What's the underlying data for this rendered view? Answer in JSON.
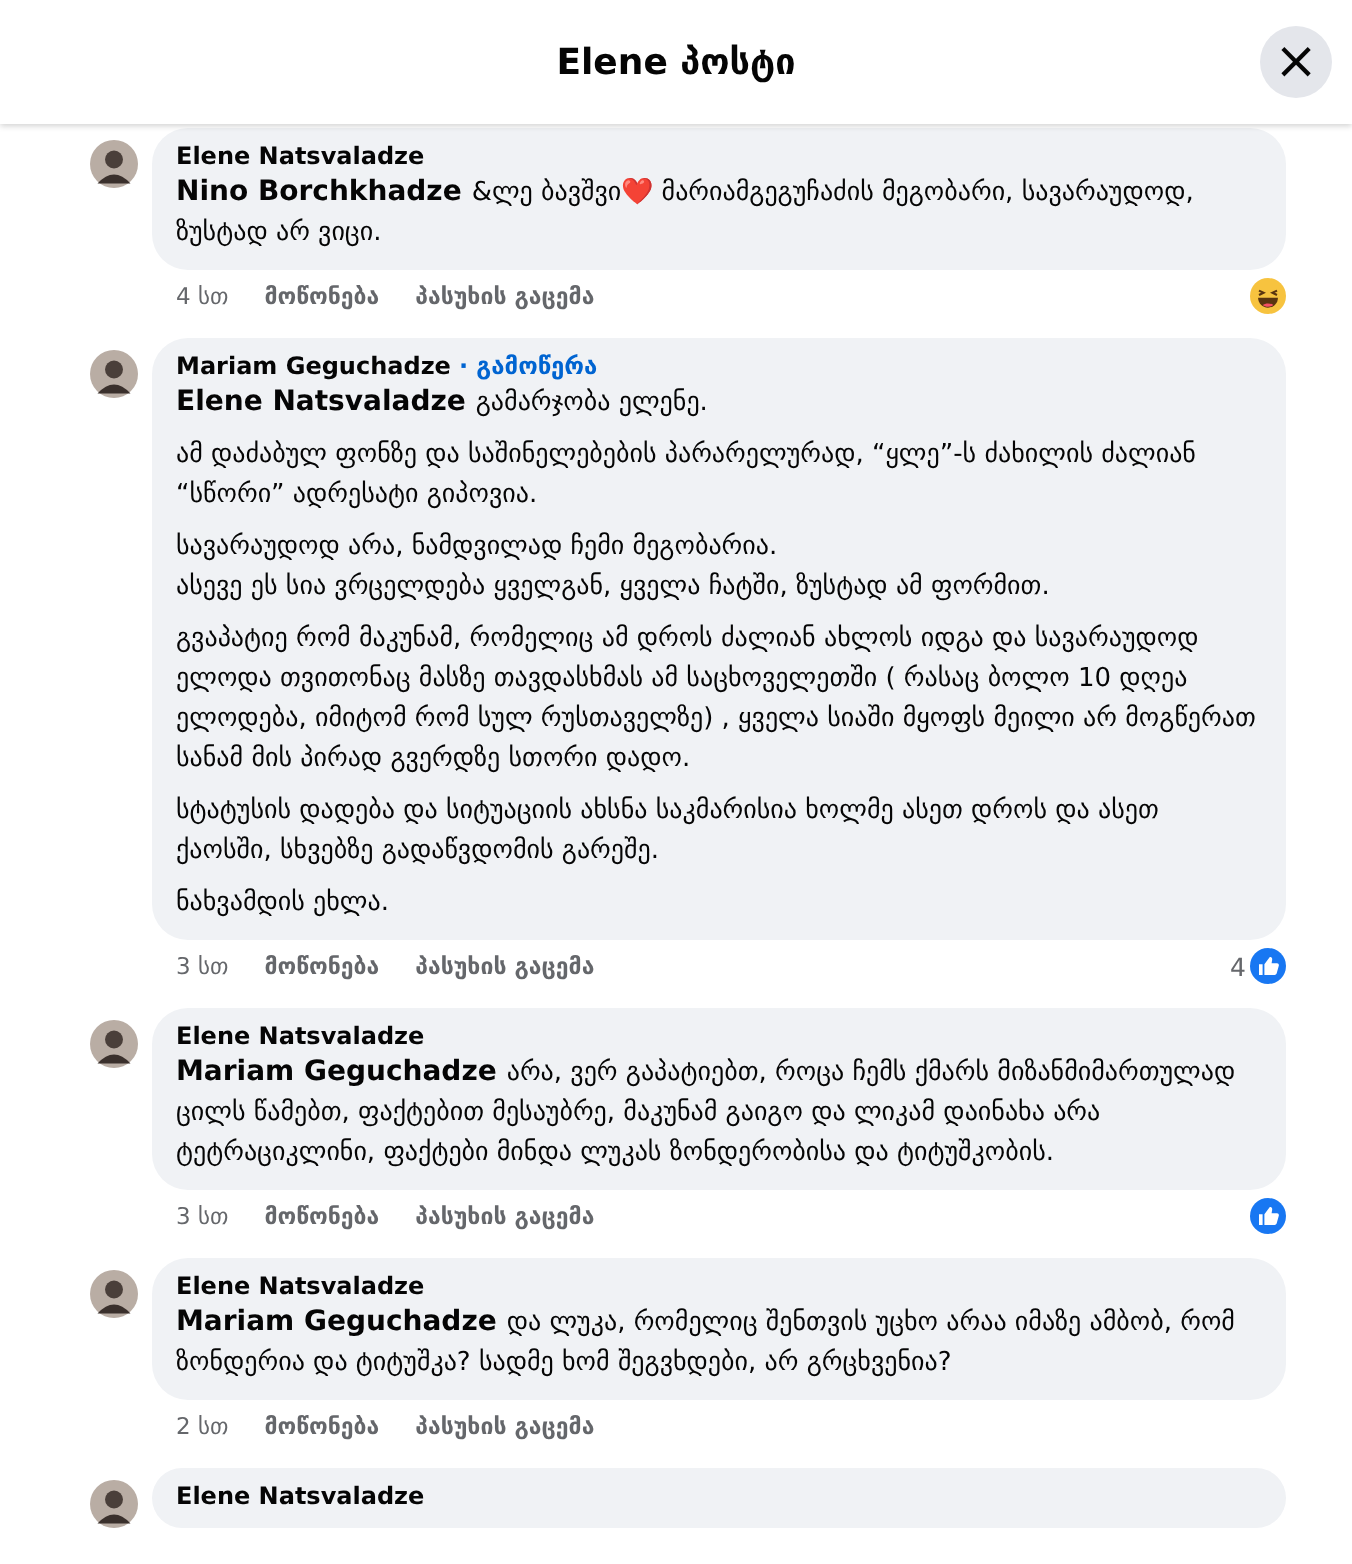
{
  "header": {
    "title": "Elene პოსტი",
    "close": "×"
  },
  "comments": [
    {
      "author": "Elene Natsvaladze",
      "mention": "Nino Borchkhadze",
      "paragraphs": [
        "&ლე ბავშვი❤️ მარიამგეგუჩაძის მეგობარი, სავარაუდოდ, ზუსტად არ ვიცი."
      ],
      "time": "4 სთ",
      "like": "მოწონება",
      "reply": "პასუხის გაცემა",
      "reaction": {
        "kind": "haha"
      }
    },
    {
      "author": "Mariam Geguchadze",
      "follow": "· გამოწერა",
      "mention": "Elene Natsvaladze",
      "paragraphs": [
        "გამარჯობა ელენე.",
        "ამ დაძაბულ ფონზე და საშინელებების პარარელურად, “ყლე”-ს ძახილის ძალიან “სწორი” ადრესატი გიპოვია.",
        "სავარაუდოდ არა, ნამდვილად ჩემი მეგობარია.\nასევე ეს სია ვრცელდება ყველგან, ყველა ჩატში, ზუსტად ამ ფორმით.",
        "გვაპატიე რომ მაკუნამ, რომელიც ამ დროს ძალიან ახლოს იდგა და სავარაუდოდ ელოდა თვითონაც მასზე თავდასხმას ამ საცხოველეთში ( რასაც ბოლო 10 დღეა ელოდება, იმიტომ რომ სულ რუსთაველზე) , ყველა სიაში მყოფს მეილი არ მოგწერათ სანამ მის პირად გვერდზე სთორი დადო.",
        "სტატუსის დადება და სიტუაციის ახსნა საკმარისია ხოლმე ასეთ დროს და ასეთ ქაოსში, სხვებზე გადაწვდომის გარეშე.",
        "ნახვამდის ეხლა."
      ],
      "time": "3 სთ",
      "like": "მოწონება",
      "reply": "პასუხის გაცემა",
      "reaction": {
        "kind": "like",
        "count": "4"
      }
    },
    {
      "author": "Elene Natsvaladze",
      "mention": "Mariam Geguchadze",
      "paragraphs": [
        "არა, ვერ გაპატიებთ, როცა ჩემს ქმარს მიზანმიმართულად ცილს წამებთ, ფაქტებით მესაუბრე, მაკუნამ გაიგო და ლიკამ დაინახა არა ტეტრაციკლინი, ფაქტები მინდა ლუკას ზონდერობისა და ტიტუშკობის."
      ],
      "time": "3 სთ",
      "like": "მოწონება",
      "reply": "პასუხის გაცემა",
      "reaction": {
        "kind": "like"
      }
    },
    {
      "author": "Elene Natsvaladze",
      "mention": "Mariam Geguchadze",
      "paragraphs": [
        "და ლუკა, რომელიც შენთვის უცხო არაა იმაზე ამბობ, რომ ზონდერია და ტიტუშკა? სადმე ხომ შეგვხდები, არ გრცხვენია?"
      ],
      "time": "2 სთ",
      "like": "მოწონება",
      "reply": "პასუხის გაცემა"
    },
    {
      "author": "Elene Natsvaladze"
    }
  ]
}
